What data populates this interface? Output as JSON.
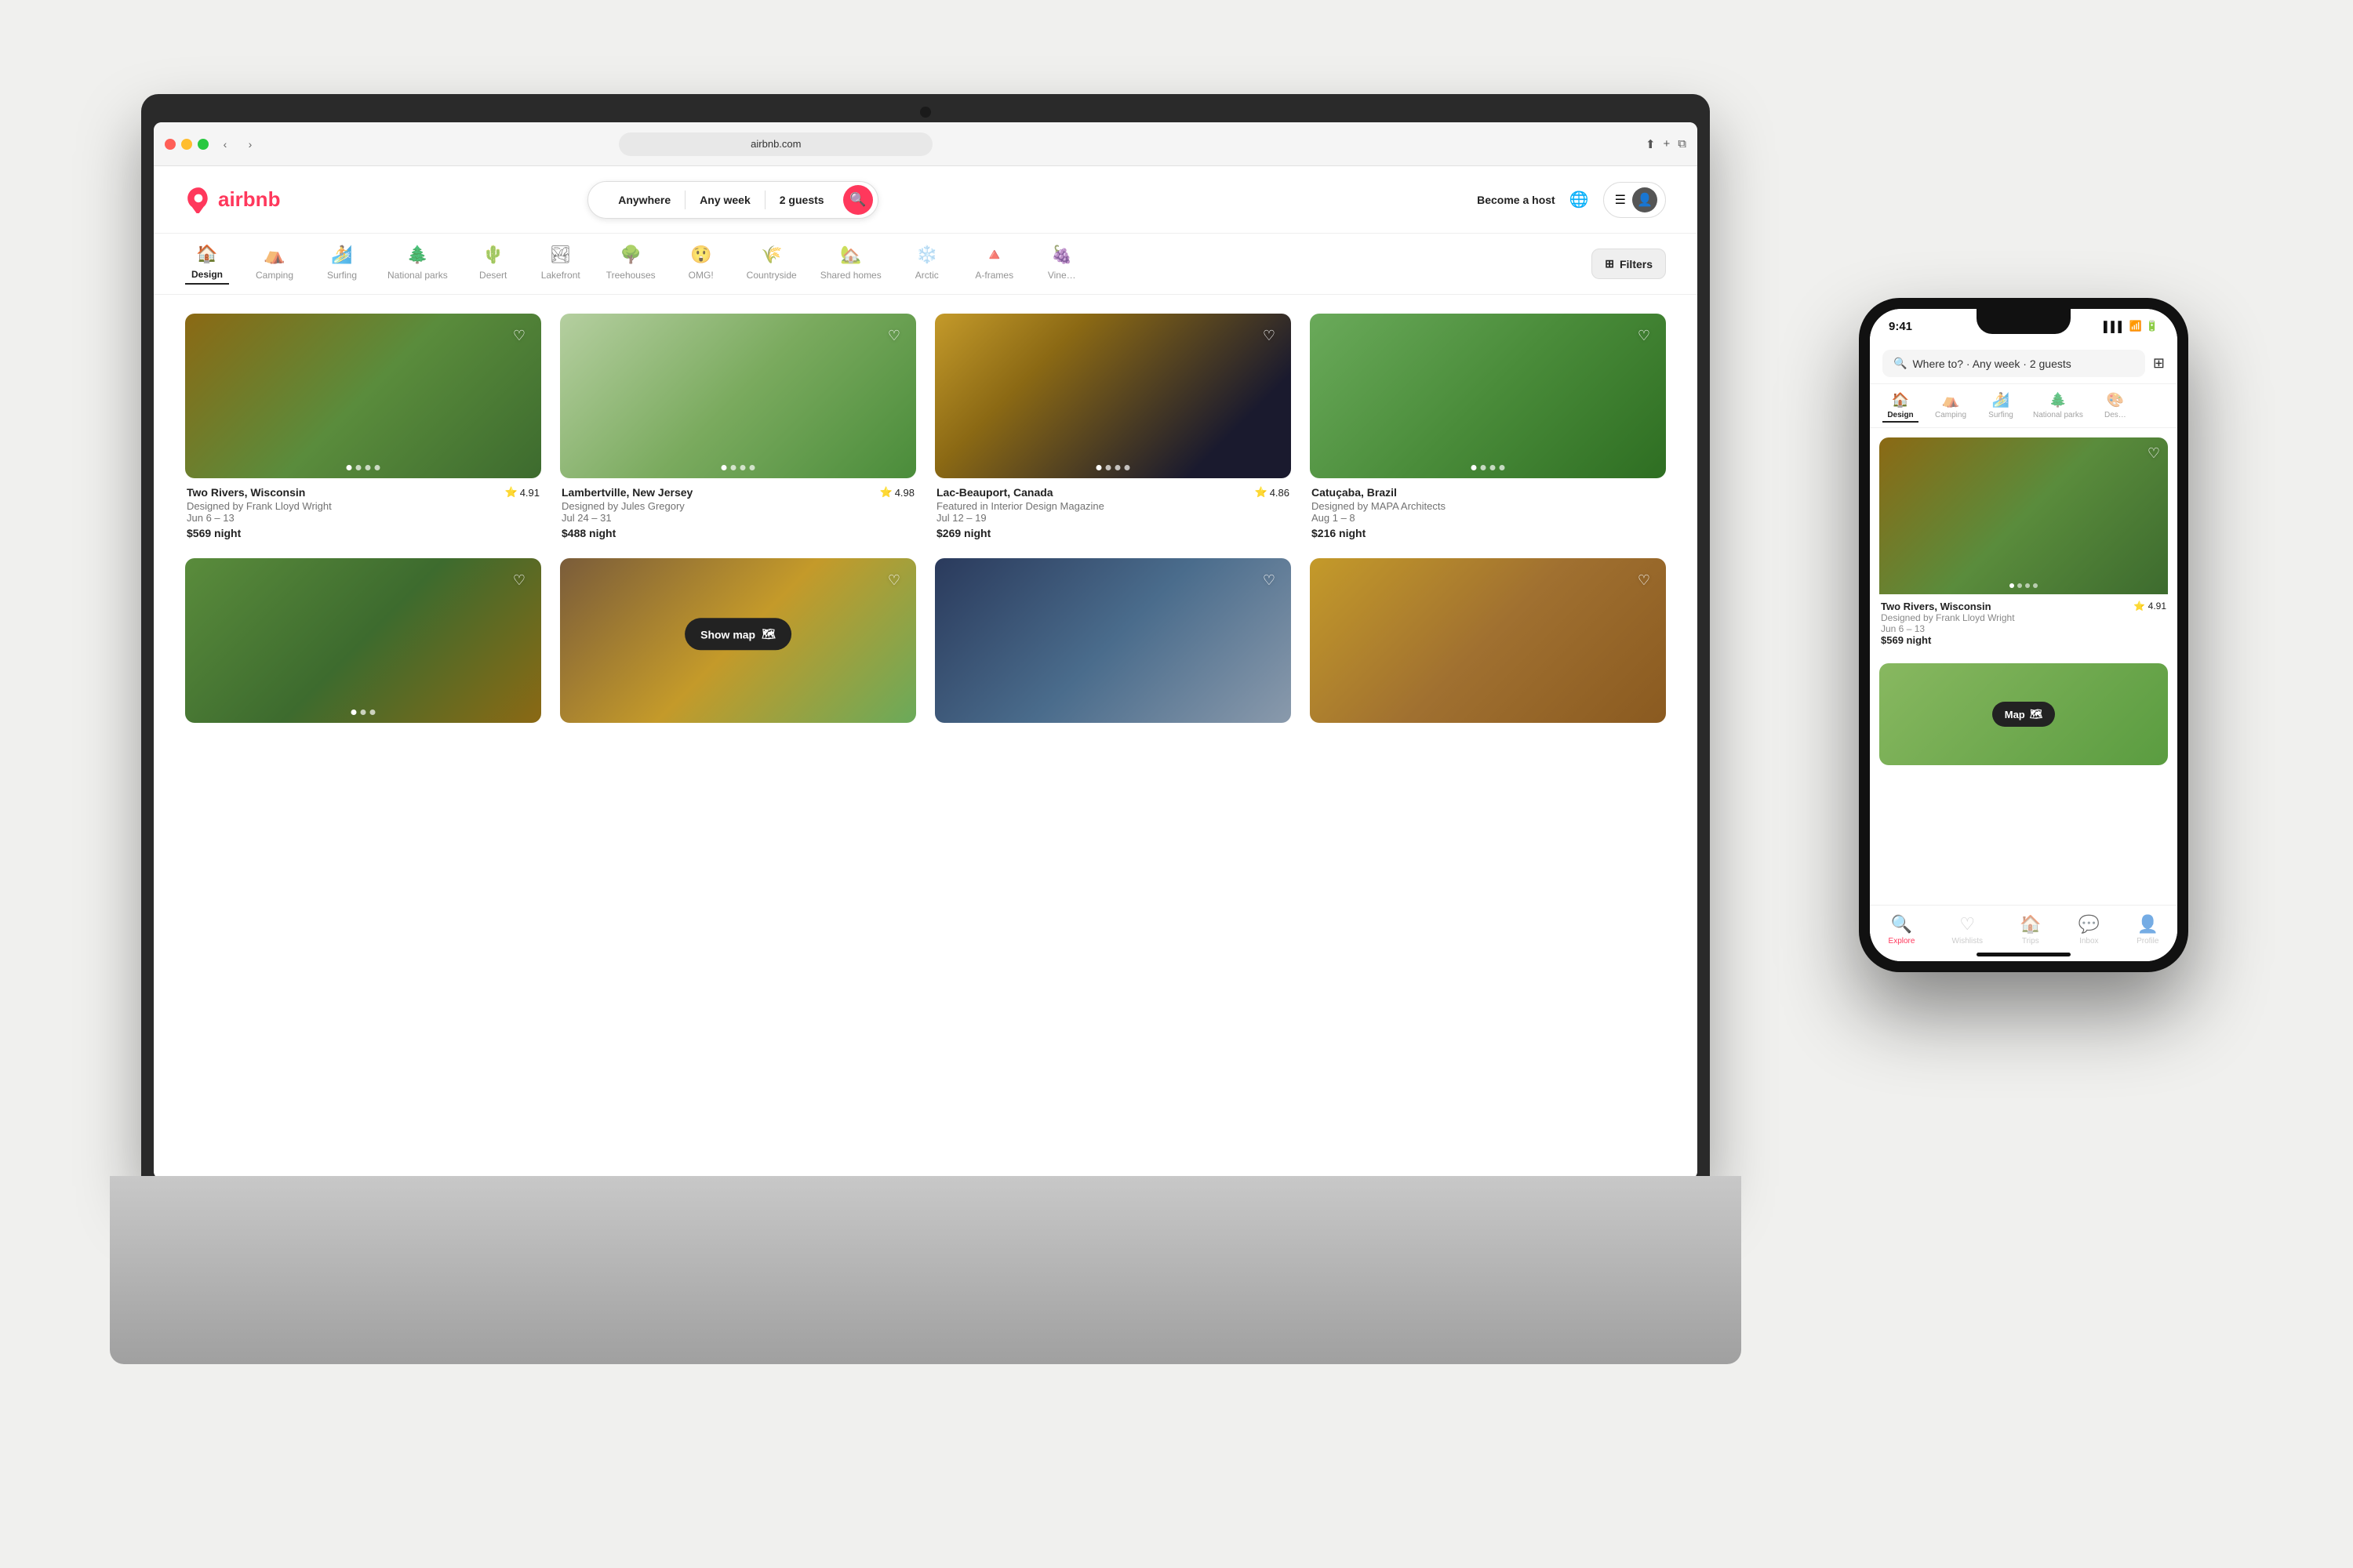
{
  "page": {
    "bg_color": "#f0f0ee"
  },
  "browser": {
    "url": "airbnb.com",
    "back_label": "‹",
    "forward_label": "›"
  },
  "airbnb": {
    "logo_text": "airbnb",
    "search": {
      "anywhere": "Anywhere",
      "any_week": "Any week",
      "guests": "2 guests"
    },
    "header_right": {
      "become_host": "Become a host",
      "filters": "Filters"
    },
    "categories": [
      {
        "id": "design",
        "label": "Design",
        "icon": "🏠",
        "active": true
      },
      {
        "id": "camping",
        "label": "Camping",
        "icon": "⛺"
      },
      {
        "id": "surfing",
        "label": "Surfing",
        "icon": "🏄"
      },
      {
        "id": "national_parks",
        "label": "National parks",
        "icon": "🌲"
      },
      {
        "id": "desert",
        "label": "Desert",
        "icon": "🌵"
      },
      {
        "id": "lakefront",
        "label": "Lakefront",
        "icon": "🏞"
      },
      {
        "id": "treehouses",
        "label": "Treehouses",
        "icon": "🌳"
      },
      {
        "id": "omg",
        "label": "OMG!",
        "icon": "😲"
      },
      {
        "id": "countryside",
        "label": "Countryside",
        "icon": "🌾"
      },
      {
        "id": "shared_homes",
        "label": "Shared homes",
        "icon": "🏡"
      },
      {
        "id": "arctic",
        "label": "Arctic",
        "icon": "❄️"
      },
      {
        "id": "a_frames",
        "label": "A-frames",
        "icon": "🔺"
      },
      {
        "id": "vineyards",
        "label": "Vine…",
        "icon": "🍇"
      }
    ],
    "listings": [
      {
        "id": 1,
        "location": "Two Rivers, Wisconsin",
        "rating": "4.91",
        "desc": "Designed by Frank Lloyd Wright",
        "dates": "Jun 6 – 13",
        "price": "$569 night",
        "img_class": "img-block-1"
      },
      {
        "id": 2,
        "location": "Lambertville, New Jersey",
        "rating": "4.98",
        "desc": "Designed by Jules Gregory",
        "dates": "Jul 24 – 31",
        "price": "$488 night",
        "img_class": "img-block-2"
      },
      {
        "id": 3,
        "location": "Lac-Beauport, Canada",
        "rating": "4.86",
        "desc": "Featured in Interior Design Magazine",
        "dates": "Jul 12 – 19",
        "price": "$269 night",
        "img_class": "img-block-3"
      },
      {
        "id": 4,
        "location": "Catuçaba, Brazil",
        "rating": "",
        "desc": "Designed by MAPA Architects",
        "dates": "Aug 1 – 8",
        "price": "$216 night",
        "img_class": "img-block-4"
      },
      {
        "id": 5,
        "location": "",
        "rating": "",
        "desc": "",
        "dates": "",
        "price": "",
        "img_class": "img-block-5"
      },
      {
        "id": 6,
        "location": "",
        "rating": "",
        "desc": "",
        "dates": "",
        "price": "",
        "img_class": "img-block-6"
      },
      {
        "id": 7,
        "location": "",
        "rating": "",
        "desc": "",
        "dates": "",
        "price": "",
        "img_class": "img-block-7"
      },
      {
        "id": 8,
        "location": "",
        "rating": "",
        "desc": "",
        "dates": "",
        "price": "",
        "img_class": "img-block-8"
      }
    ],
    "show_map": "Show map"
  },
  "phone": {
    "time": "9:41",
    "search_placeholder": "Where to? · Any week · 2 guests",
    "categories": [
      {
        "id": "design",
        "label": "Design",
        "icon": "🏠",
        "active": true
      },
      {
        "id": "camping",
        "label": "Camping",
        "icon": "⛺"
      },
      {
        "id": "surfing",
        "label": "Surfing",
        "icon": "🏄"
      },
      {
        "id": "national_parks",
        "label": "National parks",
        "icon": "🌲"
      },
      {
        "id": "design2",
        "label": "Des…",
        "icon": "🎨"
      }
    ],
    "listing": {
      "location": "Two Rivers, Wisconsin",
      "rating": "4.91",
      "desc": "Designed by Frank Lloyd Wright",
      "dates": "Jun 6 – 13",
      "price": "$569 night"
    },
    "map_label": "Map",
    "bottom_nav": [
      {
        "id": "explore",
        "label": "Explore",
        "icon": "🔍",
        "active": true
      },
      {
        "id": "wishlists",
        "label": "Wishlists",
        "icon": "♡"
      },
      {
        "id": "trips",
        "label": "Trips",
        "icon": "🏠"
      },
      {
        "id": "inbox",
        "label": "Inbox",
        "icon": "💬"
      },
      {
        "id": "profile",
        "label": "Profile",
        "icon": "👤"
      }
    ]
  }
}
